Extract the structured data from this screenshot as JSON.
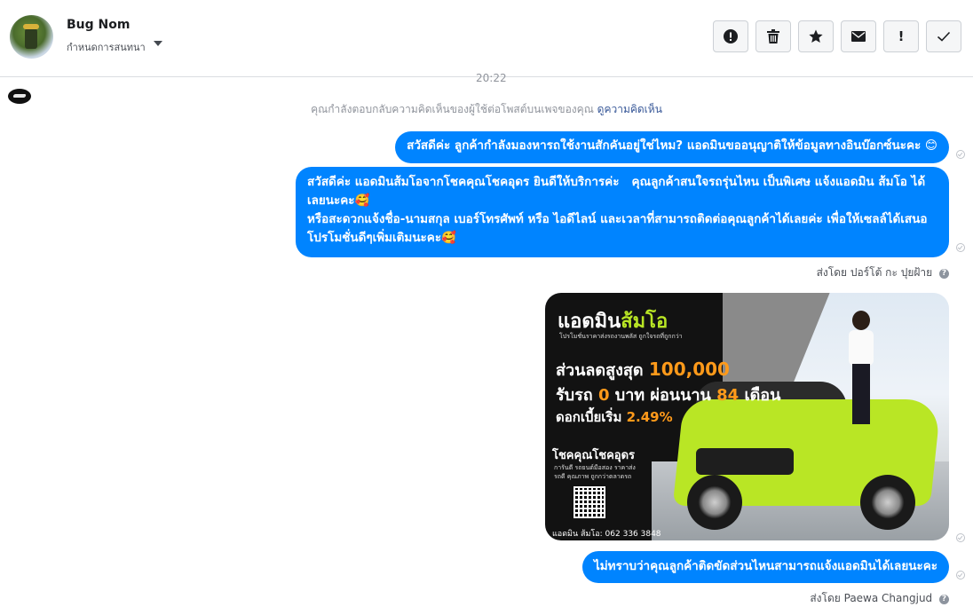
{
  "header": {
    "name": "Bug Nom",
    "assign_label": "กำหนดการสนทนา",
    "actions": [
      {
        "name": "report-spam-button",
        "icon": "alert-circle-icon"
      },
      {
        "name": "delete-button",
        "icon": "trash-icon"
      },
      {
        "name": "star-button",
        "icon": "star-icon"
      },
      {
        "name": "mark-unread-button",
        "icon": "envelope-icon"
      },
      {
        "name": "follow-up-button",
        "icon": "exclamation-icon"
      },
      {
        "name": "mark-done-button",
        "icon": "check-icon"
      }
    ],
    "follow_up_glyph": "!"
  },
  "conversation": {
    "timestamp": "20:22",
    "notice_text": "คุณกำลังตอบกลับความคิดเห็นของผู้ใช้ต่อโพสต์บนเพจของคุณ",
    "notice_link": "ดูความคิดเห็น",
    "messages": [
      {
        "text": "สวัสดีค่ะ ลูกค้ากำลังมองหารถใช้งานสักคันอยู่ใช่ไหม? แอดมินขออนุญาติให้ข้อมูลทางอินบ๊อกซ์นะคะ 😊"
      },
      {
        "text": "สวัสดีค่ะ แอดมินส้มโอจากโชคคุณโชคอุดร ยินดีให้บริการค่ะ   คุณลูกค้าสนใจรถรุ่นไหน เป็นพิเศษ แจ้งแอดมิน ส้มโอ ได้เลยนะคะ🥰\nหรือสะดวกแจ้งชื่อ-นามสกุล เบอร์โทรศัพท์ หรือ ไอดีไลน์ และเวลาที่สามารถติดต่อคุณลูกค้าได้เลยค่ะ เพื่อให้เซลล์ได้เสนอโปรโมชั่นดีๆเพิ่มเติมนะคะ🥰"
      },
      {
        "text": "ไม่ทราบว่าคุณลูกค้าติดขัดส่วนไหนสามารถแจ้งแอดมินได้เลยนะคะ"
      }
    ],
    "sent_by_1": "ส่งโดย ปอร์โต้ กะ ปุยฝ้าย",
    "sent_by_2": "ส่งโดย Paewa Changjud",
    "help_glyph": "?"
  },
  "promo": {
    "title_a": "แอดมิน",
    "title_b": "ส้มโอ",
    "subtitle": "โปรโมชั่นราคาส่งรถงานพลัส ถูกใจรถที่ถูกกว่า",
    "line1_a": "ส่วนลดสูงสุด",
    "line1_b": "100,000",
    "line2_a": "รับรถ",
    "line2_b": "0",
    "line2_c": "บาท ผ่อนนาน",
    "line2_d": "84",
    "line2_e": "เดือน",
    "line3_a": "ดอกเบี้ยเริ่ม",
    "line3_b": "2.49%",
    "brand": "โชคคุณโชคอุดร",
    "brand_sub": "การันตี รถยนต์มือสอง ราคาส่ง รถดี คุณภาพ ถูกกว่าตลาดรถ",
    "phone": "แอดมิน ส้มโอ: 062 336 3848"
  },
  "colors": {
    "bubble": "#0084ff",
    "link": "#385898",
    "accent_green": "#b9e625",
    "accent_orange": "#ff9a1a"
  }
}
